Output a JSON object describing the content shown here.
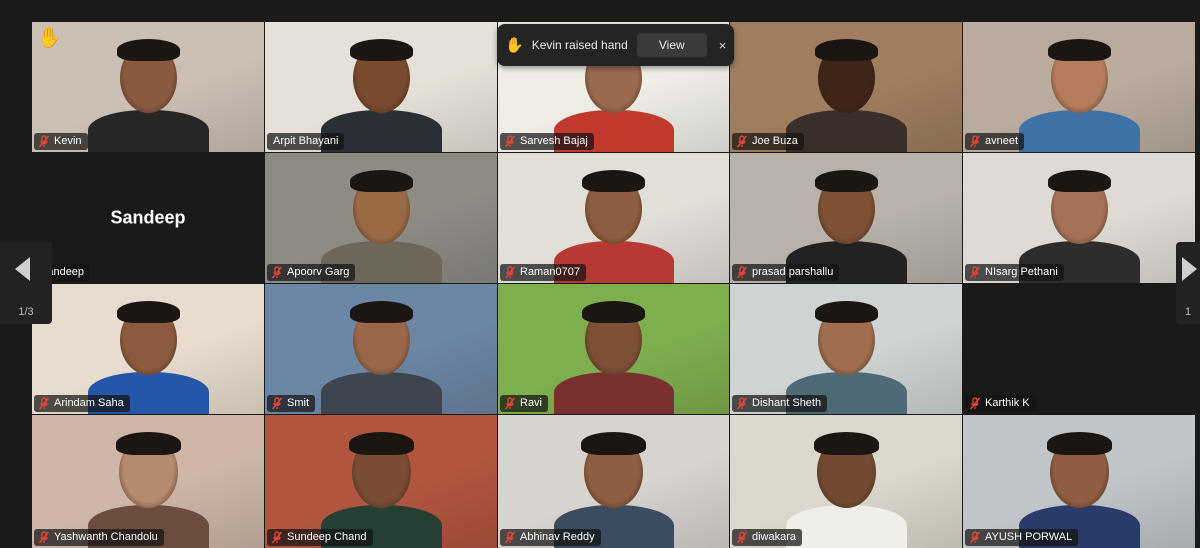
{
  "pagination": {
    "current_page": "1/3"
  },
  "notification": {
    "message": "Kevin raised hand",
    "view_label": "View",
    "close_glyph": "×",
    "hand_glyph": "✋"
  },
  "participants": [
    {
      "name": "Kevin",
      "hand_raised": true,
      "muted": true,
      "bg": "#cbbfb4",
      "skin": "#8a5a3f",
      "shirt": "#262626"
    },
    {
      "name": "Arpit Bhayani",
      "hand_raised": false,
      "muted": false,
      "speaking": true,
      "bg": "#e6e1d8",
      "skin": "#7a4a2e",
      "shirt": "#2a2f35"
    },
    {
      "name": "Sarvesh Bajaj",
      "muted": true,
      "bg": "#efede6",
      "skin": "#9a6a4e",
      "shirt": "#c2382d"
    },
    {
      "name": "Joe Buza",
      "muted": true,
      "bg": "#a07d5e",
      "skin": "#3f2418",
      "shirt": "#3a2e28"
    },
    {
      "name": "avneet",
      "muted": true,
      "bg": "#b9ab9e",
      "skin": "#b47c5c",
      "shirt": "#3f73a8"
    },
    {
      "name": "Sandeep",
      "muted": false,
      "camera_off": true,
      "bg": "#1a1a1a"
    },
    {
      "name": "Apoorv Garg",
      "muted": true,
      "bg": "#8e8b85",
      "skin": "#9a6a45",
      "shirt": "#6d6659"
    },
    {
      "name": "Raman0707",
      "muted": true,
      "bg": "#e2ded8",
      "skin": "#8c5d3f",
      "shirt": "#b63a33"
    },
    {
      "name": "prasad parshallu",
      "muted": true,
      "bg": "#b8b2aa",
      "skin": "#7e5034",
      "shirt": "#222222"
    },
    {
      "name": "NIsarg Pethani",
      "muted": true,
      "bg": "#dedbd6",
      "skin": "#a57256",
      "shirt": "#2d2d2d"
    },
    {
      "name": "Arindam Saha",
      "muted": true,
      "bg": "#e7dccd",
      "skin": "#8c5b3e",
      "shirt": "#2457a8"
    },
    {
      "name": "Smit",
      "muted": true,
      "bg": "#6c86a5",
      "skin": "#9a6849",
      "shirt": "#3c4550"
    },
    {
      "name": "Ravi",
      "muted": true,
      "bg": "#7fae4e",
      "skin": "#7d4f35",
      "shirt": "#7a3030"
    },
    {
      "name": "Dishant Sheth",
      "muted": true,
      "bg": "#cfd3d3",
      "skin": "#a06e4f",
      "shirt": "#4f6a77"
    },
    {
      "name": "Karthik K",
      "muted": true,
      "camera_off": true,
      "bg": "#1a1a1a"
    },
    {
      "name": "Yashwanth Chandolu",
      "muted": true,
      "bg": "#cdb6a8",
      "skin": "#b58a6d",
      "shirt": "#6b4c3f"
    },
    {
      "name": "Sundeep Chand",
      "muted": true,
      "bg": "#b3563f",
      "skin": "#7a4c34",
      "shirt": "#253f35"
    },
    {
      "name": "Abhinav Reddy",
      "muted": true,
      "bg": "#d7d3ce",
      "skin": "#8e5e40",
      "shirt": "#3b4c5e"
    },
    {
      "name": "diwakara",
      "muted": true,
      "bg": "#dcd7cc",
      "skin": "#734a31",
      "shirt": "#f0eee8"
    },
    {
      "name": "AYUSH PORWAL",
      "muted": true,
      "bg": "#bfc5c9",
      "skin": "#8f5e40",
      "shirt": "#2b3b69"
    }
  ],
  "colors": {
    "background": "#1a1a1a",
    "speaking_border": "#2bd36b",
    "mute_icon": "#e0453a",
    "nametag_bg": "rgba(20,20,20,0.72)"
  },
  "icons": {
    "nav_left": "chevron-left-icon",
    "nav_right": "chevron-right-icon",
    "muted": "mic-muted-icon",
    "hand": "raised-hand-icon"
  }
}
